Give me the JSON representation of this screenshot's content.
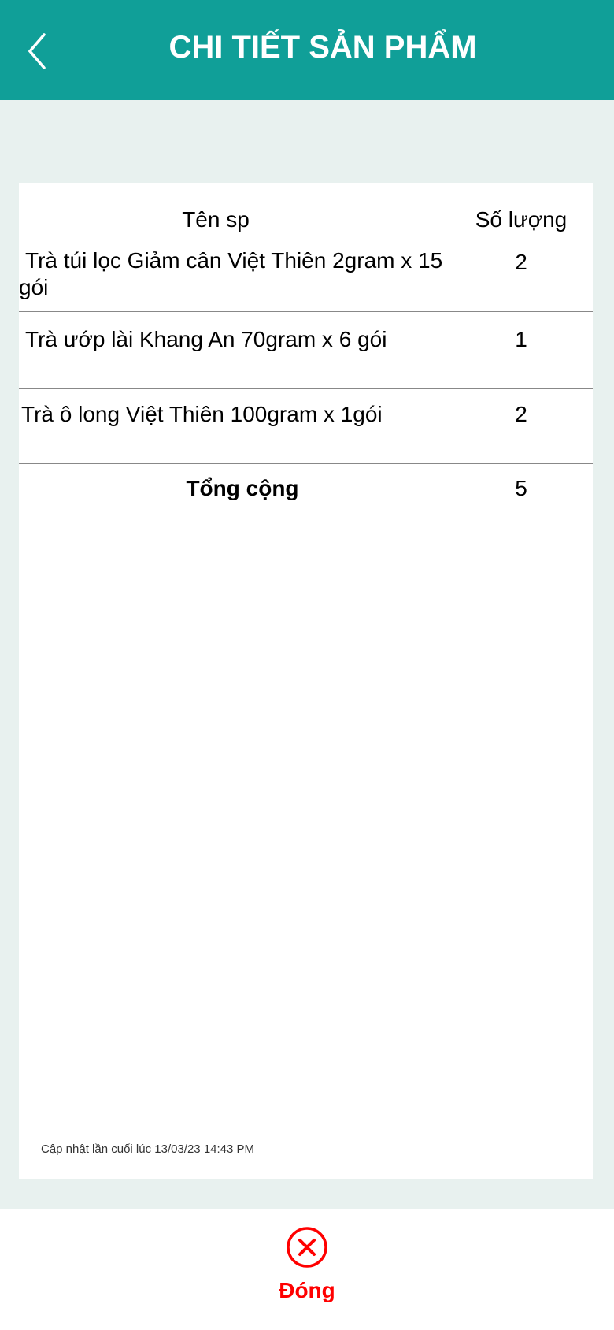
{
  "header": {
    "title": "CHI TIẾT SẢN PHẨM",
    "back_icon": "chevron-left-icon"
  },
  "table": {
    "headers": [
      "Tên sp",
      "Số lượng"
    ],
    "rows": [
      {
        "name": "Trà túi lọc Giảm cân Việt Thiên 2gram x 15 gói",
        "qty": "2"
      },
      {
        "name": "Trà ướp lài Khang An 70gram x 6 gói",
        "qty": "1"
      },
      {
        "name": "Trà ô long Việt Thiên 100gram x 1gói",
        "qty": "2"
      }
    ],
    "total_label": "Tổng cộng",
    "total_value": "5"
  },
  "last_updated": "Cập nhật lần cuối lúc 13/03/23 14:43 PM",
  "footer": {
    "close_label": "Đóng",
    "close_icon": "circle-x-icon",
    "accent": "#ff0000"
  },
  "colors": {
    "header": "#109f98",
    "background": "#e8f1ef"
  }
}
